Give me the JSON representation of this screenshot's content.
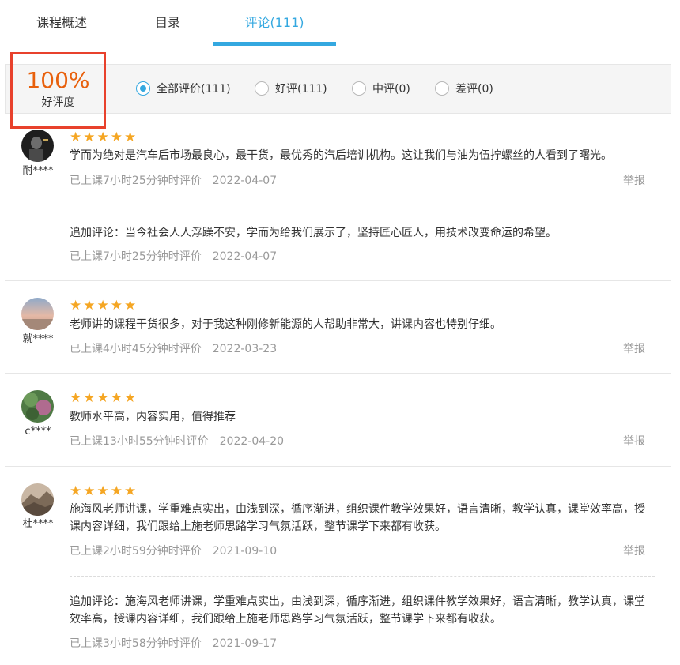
{
  "tabs": {
    "overview": "课程概述",
    "catalog": "目录",
    "comments": "评论(111)"
  },
  "score": {
    "value": "100%",
    "label": "好评度"
  },
  "filters": [
    {
      "label": "全部评价(111)",
      "selected": true
    },
    {
      "label": "好评(111)",
      "selected": false
    },
    {
      "label": "中评(0)",
      "selected": false
    },
    {
      "label": "差评(0)",
      "selected": false
    }
  ],
  "stars": "★★★★★",
  "report_label": "举报",
  "colors": {
    "accent": "#34a8e0",
    "score": "#e8600c",
    "highlight_border": "#e8412c",
    "star": "#f5a623"
  },
  "reviews": [
    {
      "user": "耐****",
      "rating": 5,
      "text": "学而为绝对是汽车后市场最良心，最干货，最优秀的汽后培训机构。这让我们与油为伍拧螺丝的人看到了曙光。",
      "meta": "已上课7小时25分钟时评价",
      "date": "2022-04-07",
      "followup_text": "追加评论：当今社会人人浮躁不安，学而为给我们展示了，坚持匠心匠人，用技术改变命运的希望。",
      "followup_meta": "已上课7小时25分钟时评价",
      "followup_date": "2022-04-07"
    },
    {
      "user": "就****",
      "rating": 5,
      "text": "老师讲的课程干货很多，对于我这种刚修新能源的人帮助非常大，讲课内容也特别仔细。",
      "meta": "已上课4小时45分钟时评价",
      "date": "2022-03-23"
    },
    {
      "user": "c****",
      "rating": 5,
      "text": "教师水平高，内容实用，值得推荐",
      "meta": "已上课13小时55分钟时评价",
      "date": "2022-04-20"
    },
    {
      "user": "杜****",
      "rating": 5,
      "text": "施海风老师讲课，学重难点实出，由浅到深，循序渐进，组织课件教学效果好，语言清晰，教学认真，课堂效率高，授课内容详细，我们跟给上施老师思路学习气氛活跃，整节课学下来都有收获。",
      "meta": "已上课2小时59分钟时评价",
      "date": "2021-09-10",
      "followup_text": "追加评论：施海风老师讲课，学重难点实出，由浅到深，循序渐进，组织课件教学效果好，语言清晰，教学认真，课堂效率高，授课内容详细，我们跟给上施老师思路学习气氛活跃，整节课学下来都有收获。",
      "followup_meta": "已上课3小时58分钟时评价",
      "followup_date": "2021-09-17"
    }
  ]
}
